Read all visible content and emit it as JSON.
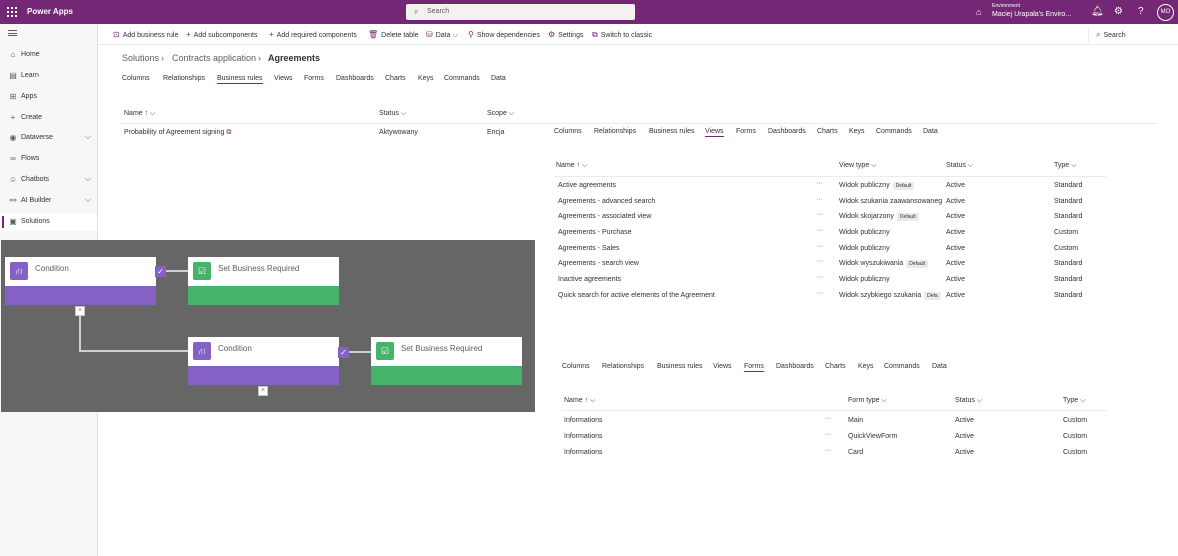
{
  "topbar": {
    "app_title": "Power Apps",
    "search_placeholder": "Search",
    "env_label": "Environment",
    "env_name": "Maciej Urapała's Enviro...",
    "avatar_initials": "MO"
  },
  "nav": {
    "items": [
      {
        "label": "Home"
      },
      {
        "label": "Learn"
      },
      {
        "label": "Apps"
      },
      {
        "label": "Create"
      },
      {
        "label": "Dataverse"
      },
      {
        "label": "Flows"
      },
      {
        "label": "Chatbots"
      },
      {
        "label": "AI Builder"
      },
      {
        "label": "Solutions"
      }
    ]
  },
  "cmdbar": {
    "add_business_rule": "Add business rule",
    "add_subcomponents": "Add subcomponents",
    "add_required_components": "Add required components",
    "delete_table": "Delete table",
    "data": "Data",
    "show_dependencies": "Show dependencies",
    "settings": "Settings",
    "switch_to_classic": "Switch to classic",
    "search": "Search"
  },
  "breadcrumb": {
    "solutions": "Solutions",
    "contracts": "Contracts application",
    "current": "Agreements"
  },
  "main_tabs": [
    "Columns",
    "Relationships",
    "Business rules",
    "Views",
    "Forms",
    "Dashboards",
    "Charts",
    "Keys",
    "Commands",
    "Data"
  ],
  "rules_table": {
    "headers": {
      "name": "Name ↑ ⌵",
      "status": "Status ⌵",
      "scope": "Scope ⌵"
    },
    "rows": [
      {
        "name": "Probability of Agreement signing",
        "status": "Aktywowany",
        "scope": "Encja"
      }
    ]
  },
  "views_panel": {
    "tabs": [
      "Columns",
      "Relationships",
      "Business rules",
      "Views",
      "Forms",
      "Dashboards",
      "Charts",
      "Keys",
      "Commands",
      "Data"
    ],
    "headers": {
      "name": "Name ↑ ⌵",
      "view_type": "View type ⌵",
      "status": "Status ⌵",
      "type": "Type ⌵"
    },
    "rows": [
      {
        "name": "Active agreements",
        "view_type": "Widok publiczny",
        "badge": "Default",
        "status": "Active",
        "type": "Standard"
      },
      {
        "name": "Agreements - advanced search",
        "view_type": "Widok szukania zaawansowaneg",
        "badge": "",
        "status": "Active",
        "type": "Standard"
      },
      {
        "name": "Agreements - associated view",
        "view_type": "Widok skojarzony",
        "badge": "Default",
        "status": "Active",
        "type": "Standard"
      },
      {
        "name": "Agreements - Purchase",
        "view_type": "Widok publiczny",
        "badge": "",
        "status": "Active",
        "type": "Custom"
      },
      {
        "name": "Agreements - Sales",
        "view_type": "Widok publiczny",
        "badge": "",
        "status": "Active",
        "type": "Custom"
      },
      {
        "name": "Agreements - search view",
        "view_type": "Widok wyszukiwania",
        "badge": "Default",
        "status": "Active",
        "type": "Standard"
      },
      {
        "name": "Inactive agreements",
        "view_type": "Widok publiczny",
        "badge": "",
        "status": "Active",
        "type": "Standard"
      },
      {
        "name": "Quick search for active elements of the Agreement",
        "view_type": "Widok szybkiego szukania",
        "badge": "Defa",
        "status": "Active",
        "type": "Standard"
      }
    ]
  },
  "forms_panel": {
    "tabs": [
      "Columns",
      "Relationships",
      "Business rules",
      "Views",
      "Forms",
      "Dashboards",
      "Charts",
      "Keys",
      "Commands",
      "Data"
    ],
    "headers": {
      "name": "Name ↑ ⌵",
      "form_type": "Form type ⌵",
      "status": "Status ⌵",
      "type": "Type ⌵"
    },
    "rows": [
      {
        "name": "Informations",
        "form_type": "Main",
        "status": "Active",
        "type": "Custom"
      },
      {
        "name": "Informations",
        "form_type": "QuickViewForm",
        "status": "Active",
        "type": "Custom"
      },
      {
        "name": "Informations",
        "form_type": "Card",
        "status": "Active",
        "type": "Custom"
      }
    ]
  },
  "diagram": {
    "condition_1": "Condition",
    "action_1": "Set Business Required",
    "condition_2": "Condition",
    "action_2": "Set Business Required"
  },
  "colors": {
    "brand": "#742774",
    "condition": "#8661c5",
    "action": "#46b36b",
    "canvas": "#666666"
  }
}
